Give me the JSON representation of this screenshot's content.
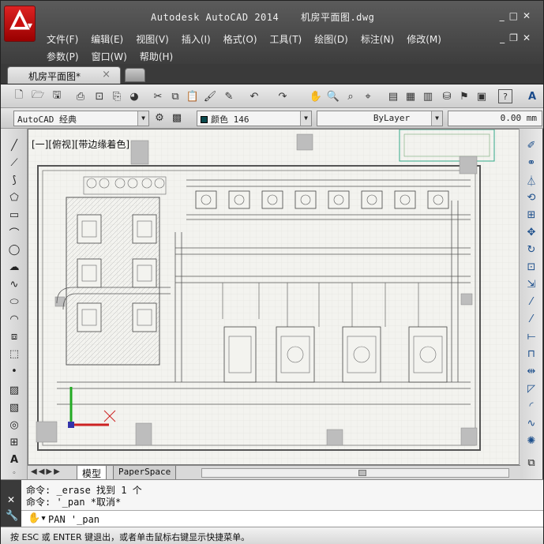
{
  "window": {
    "app_title": "Autodesk AutoCAD 2014",
    "doc_title": "机房平面图.dwg"
  },
  "menu": {
    "row1": [
      "文件(F)",
      "编辑(E)",
      "视图(V)",
      "插入(I)",
      "格式(O)",
      "工具(T)",
      "绘图(D)",
      "标注(N)",
      "修改(M)"
    ],
    "row2": [
      "参数(P)",
      "窗口(W)",
      "帮助(H)"
    ]
  },
  "tabs": {
    "doc_tab": "机房平面图*",
    "close_glyph": "×"
  },
  "toolbar2": {
    "workspace": "AutoCAD 经典",
    "color": "颜色 146",
    "linetype": "ByLayer",
    "lineweight": "0.00 mm"
  },
  "canvas": {
    "viewport_label": "[一][俯视][带边缘着色]",
    "floor_color": "#f3f3ef",
    "line_color": "#5a5a5a"
  },
  "layout_tabs": {
    "model": "模型",
    "paper": "PaperSpace"
  },
  "command": {
    "line1": "命令: _erase 找到 1 个",
    "line2": "命令: '_pan *取消*",
    "input": "PAN '_pan"
  },
  "status": {
    "text": "按 ESC 或 ENTER 键退出，或者单击鼠标右键显示快捷菜单。"
  },
  "icons": {
    "left": [
      "line-icon",
      "polyline-icon",
      "construction-line-icon",
      "polygon-icon",
      "rectangle-icon",
      "arc-icon",
      "circle-icon",
      "revision-cloud-icon",
      "spline-icon",
      "ellipse-icon",
      "ellipse-arc-icon",
      "insert-block-icon",
      "make-block-icon",
      "point-icon",
      "hatch-icon",
      "gradient-icon",
      "region-icon",
      "table-icon",
      "multiline-text-icon",
      "add-selected-icon"
    ],
    "right": [
      "erase-icon",
      "copy-icon",
      "mirror-icon",
      "offset-icon",
      "array-icon",
      "move-icon",
      "rotate-icon",
      "scale-icon",
      "stretch-icon",
      "trim-icon",
      "extend-icon",
      "break-at-point-icon",
      "break-icon",
      "join-icon",
      "chamfer-icon",
      "fillet-icon",
      "blend-curves-icon",
      "explode-icon",
      "layer-icon"
    ]
  }
}
